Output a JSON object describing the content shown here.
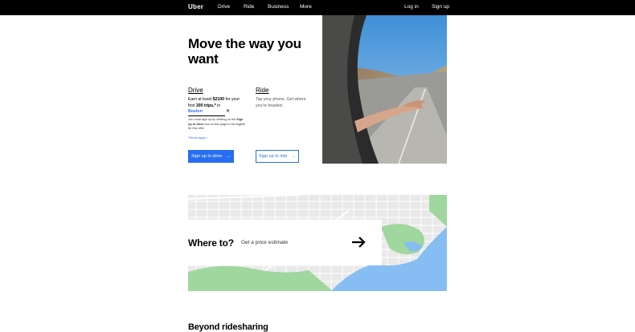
{
  "nav": {
    "logo": "Uber",
    "links": [
      "Drive",
      "Ride",
      "Business",
      "More"
    ],
    "login": "Log in",
    "signup": "Sign up"
  },
  "hero": {
    "title": "Move the way you want",
    "drive": {
      "heading": "Drive",
      "earn_prefix": "Earn at least",
      "amount": "$2100",
      "earn_mid": "for your first",
      "trips": "300 trips,*",
      "in": "in",
      "city": "Boston",
      "fine_print_1": "You must sign up by clicking on the",
      "fine_print_bold": "Sign up to drive",
      "fine_print_2": "box on this page to be eligible for this offer",
      "terms": "*Terms apply",
      "button": "Sign up to drive"
    },
    "ride": {
      "heading": "Ride",
      "text": "Tap your phone. Get where you're headed.",
      "button": "Sign up to ride"
    }
  },
  "map_section": {
    "title": "Where to?",
    "estimate": "Get a price estimate"
  },
  "next_section": {
    "title": "Beyond ridesharing"
  },
  "colors": {
    "accent": "#276EF1",
    "nav_bg": "#000000",
    "water": "#86BEF3",
    "park": "#9FD79F"
  }
}
